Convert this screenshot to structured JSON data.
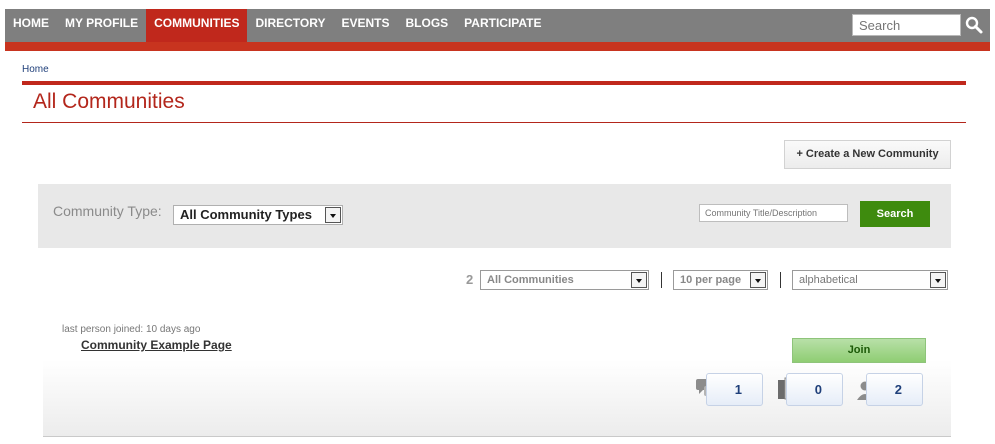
{
  "nav": {
    "items": [
      {
        "label": "HOME",
        "active": false
      },
      {
        "label": "MY PROFILE",
        "active": false
      },
      {
        "label": "COMMUNITIES",
        "active": true
      },
      {
        "label": "DIRECTORY",
        "active": false
      },
      {
        "label": "EVENTS",
        "active": false
      },
      {
        "label": "BLOGS",
        "active": false
      },
      {
        "label": "PARTICIPATE",
        "active": false
      }
    ],
    "search_placeholder": "Search"
  },
  "breadcrumb": "Home",
  "page_title": "All Communities",
  "create_button": "+ Create a New Community",
  "filter": {
    "type_label": "Community Type:",
    "type_value": "All Community Types",
    "title_placeholder": "Community Title/Description",
    "search_button": "Search"
  },
  "sort": {
    "count": "2",
    "scope": "All Communities",
    "per_page": "10 per page",
    "order": "alphabetical"
  },
  "community": {
    "last_joined": "last person joined: 10 days ago",
    "name": "Community Example Page",
    "join_button": "Join",
    "stats": {
      "discussions": "1",
      "documents": "0",
      "members": "2"
    }
  },
  "colors": {
    "accent_red": "#c0281c",
    "nav_gray": "#7f7f7f",
    "search_green": "#3e8b0e"
  },
  "icons": [
    "search-icon",
    "chat-bubbles-icon",
    "document-icon",
    "members-icon",
    "chevron-down-icon"
  ]
}
